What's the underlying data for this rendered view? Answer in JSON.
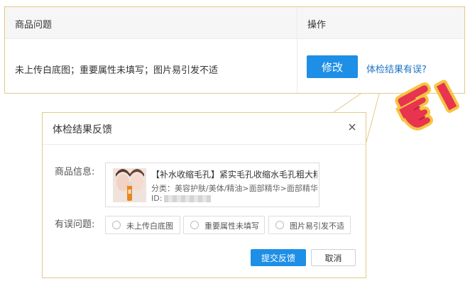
{
  "table": {
    "header_problem": "商品问题",
    "header_action": "操作",
    "row_problem": "未上传白底图；重要属性未填写；图片易引发不适",
    "modify_label": "修改",
    "report_link": "体检结果有误?"
  },
  "dialog": {
    "title": "体检结果反馈",
    "close_icon": "close-icon",
    "product_label": "商品信息:",
    "product": {
      "title": "【补水收缩毛孔】紧实毛孔收缩水毛孔粗大精...",
      "category": "分类：美容护肤/美体/精油>面部精华>面部精华",
      "id_label": "ID:"
    },
    "issue_label": "有误问题:",
    "options": [
      {
        "label": "未上传白底图",
        "checked": false
      },
      {
        "label": "重要属性未填写",
        "checked": false
      },
      {
        "label": "图片易引发不适",
        "checked": false
      }
    ],
    "submit_label": "提交反馈",
    "cancel_label": "取消"
  },
  "colors": {
    "primary": "#1e8fe6",
    "link": "#1d72c6",
    "highlight_border": "#e4c98a",
    "pointer_red": "#e8344e",
    "pointer_outline": "#f5c542"
  }
}
